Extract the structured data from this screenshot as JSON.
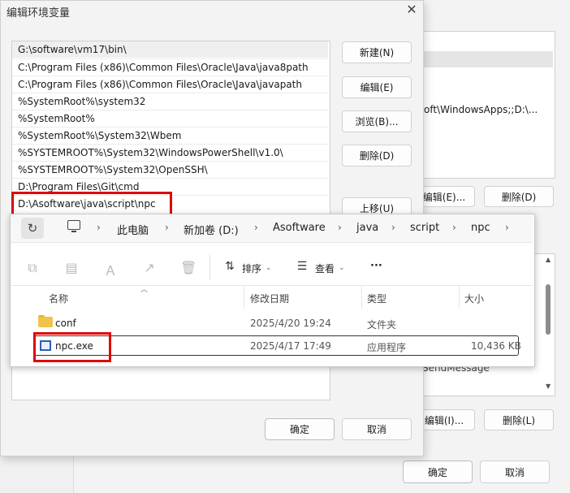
{
  "env_dialog": {
    "title": "编辑环境变量",
    "close_glyph": "✕",
    "paths": [
      "G:\\software\\vm17\\bin\\",
      "C:\\Program Files (x86)\\Common Files\\Oracle\\Java\\java8path",
      "C:\\Program Files (x86)\\Common Files\\Oracle\\Java\\javapath",
      "%SystemRoot%\\system32",
      "%SystemRoot%",
      "%SystemRoot%\\System32\\Wbem",
      "%SYSTEMROOT%\\System32\\WindowsPowerShell\\v1.0\\",
      "%SYSTEMROOT%\\System32\\OpenSSH\\",
      "D:\\Program Files\\Git\\cmd",
      "D:\\Asoftware\\java\\script\\npc"
    ],
    "buttons": {
      "new": "新建(N)",
      "edit": "编辑(E)",
      "browse": "浏览(B)...",
      "delete": "删除(D)",
      "move_up": "上移(U)",
      "ok": "确定",
      "cancel": "取消"
    }
  },
  "bg_dialog": {
    "list_text": "oft\\WindowsApps;;D:\\...",
    "list2_text": "SendMessage",
    "edit_button_top": "编辑(E)...",
    "delete_button_top": "删除(D)",
    "edit_button_bottom": "编辑(I)...",
    "delete_button_bottom": "删除(L)",
    "ok": "确定",
    "cancel": "取消"
  },
  "explorer": {
    "breadcrumbs": [
      "此电脑",
      "新加卷 (D:)",
      "Asoftware",
      "java",
      "script",
      "npc"
    ],
    "toolbar": {
      "sort": "排序",
      "view": "查看",
      "more": "···"
    },
    "columns": {
      "name": "名称",
      "modified": "修改日期",
      "type": "类型",
      "size": "大小"
    },
    "files": [
      {
        "name": "conf",
        "modified": "2025/4/20 19:24",
        "type": "文件夹",
        "size": ""
      },
      {
        "name": "npc.exe",
        "modified": "2025/4/17 17:49",
        "type": "应用程序",
        "size": "10,436 KB"
      }
    ]
  },
  "colors": {
    "highlight": "#e00000",
    "folder": "#f0c34a",
    "exe": "#2c5fb3"
  }
}
